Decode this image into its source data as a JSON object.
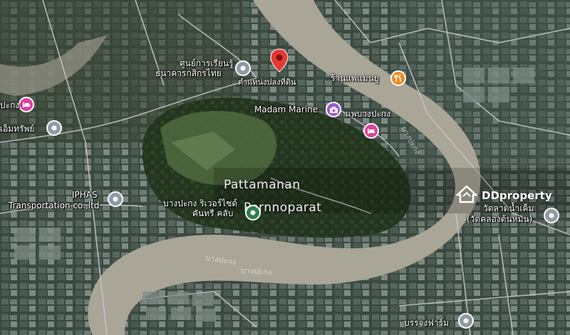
{
  "map": {
    "listing_title_line1": "Pattamanan",
    "listing_title_line2": "Pornnoparat",
    "watermark": "DDproperty",
    "colors": {
      "river": "#a9a597",
      "pin_red": "#e53935",
      "pin_gray": "#8f9aa3",
      "pin_pink": "#e040a0",
      "pin_orange": "#f2891f",
      "pin_purple": "#9b59d0"
    },
    "labels": {
      "kasikorn_line1": "ศูนย์การเรียนรู้",
      "kasikorn_line2": "ธนาคารกสิกรไทย",
      "dropped_pin": "ตำแหน่งปลงที่ดิน",
      "restaurant": "ร้านแพแมนยู",
      "madam_marine": "Madam Marine",
      "phae_bang": "แพบางปะกง",
      "left_top": "ปะกง",
      "emthap": "เอ็มทรัพย์",
      "iphas_line1": "IPHAS",
      "iphas_line2": "Transportation co.,ltd",
      "bangpakong_line1": "บางปะกง ริเวอร์ไซด์",
      "bangpakong_line2": "คันทรี คลับ",
      "temple_line1": "วัดลาดน้ำเค็ม",
      "temple_line2": "(วัดคลองต้นหมัน)",
      "bunjong": "บรรจงฟาร์ม",
      "river_1": "บางปะกง",
      "river_2": "บางปะกง",
      "river_3": "บางปะกง"
    },
    "icons": {
      "dropped_pin": "map-marker-icon",
      "restaurant": "fork-knife-icon",
      "hotel": "bed-icon",
      "camera": "camera-icon",
      "place": "place-dot-icon",
      "watermark": "house-logo-icon"
    }
  }
}
